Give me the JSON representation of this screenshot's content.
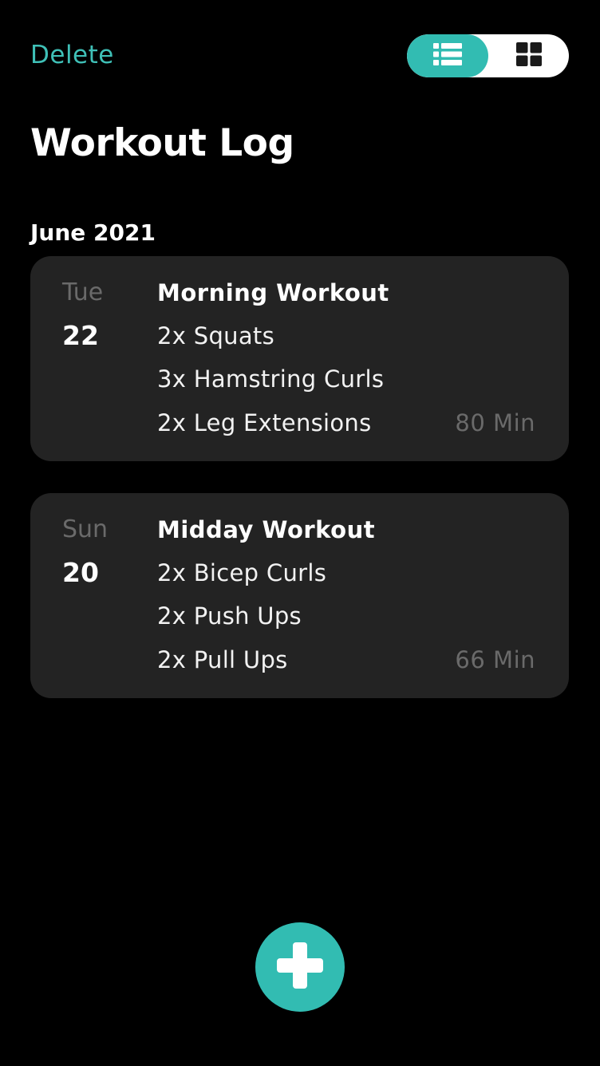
{
  "header": {
    "delete_label": "Delete",
    "view_toggle": {
      "options": [
        {
          "icon": "list-icon",
          "selected": true
        },
        {
          "icon": "grid-icon",
          "selected": false
        }
      ]
    }
  },
  "page": {
    "title": "Workout Log"
  },
  "colors": {
    "accent": "#32bcb2",
    "background": "#000000",
    "card": "#232323",
    "muted": "#6a6a6a"
  },
  "sections": [
    {
      "heading": "June 2021",
      "workouts": [
        {
          "day_name": "Tue",
          "day_num": "22",
          "title": "Morning Workout",
          "exercises": [
            "2x Squats",
            "3x Hamstring Curls",
            "2x Leg Extensions"
          ],
          "duration": "80 Min"
        },
        {
          "day_name": "Sun",
          "day_num": "20",
          "title": "Midday Workout",
          "exercises": [
            "2x Bicep Curls",
            "2x Push Ups",
            "2x Pull Ups"
          ],
          "duration": "66 Min"
        }
      ]
    }
  ],
  "fab": {
    "icon": "plus-icon"
  }
}
